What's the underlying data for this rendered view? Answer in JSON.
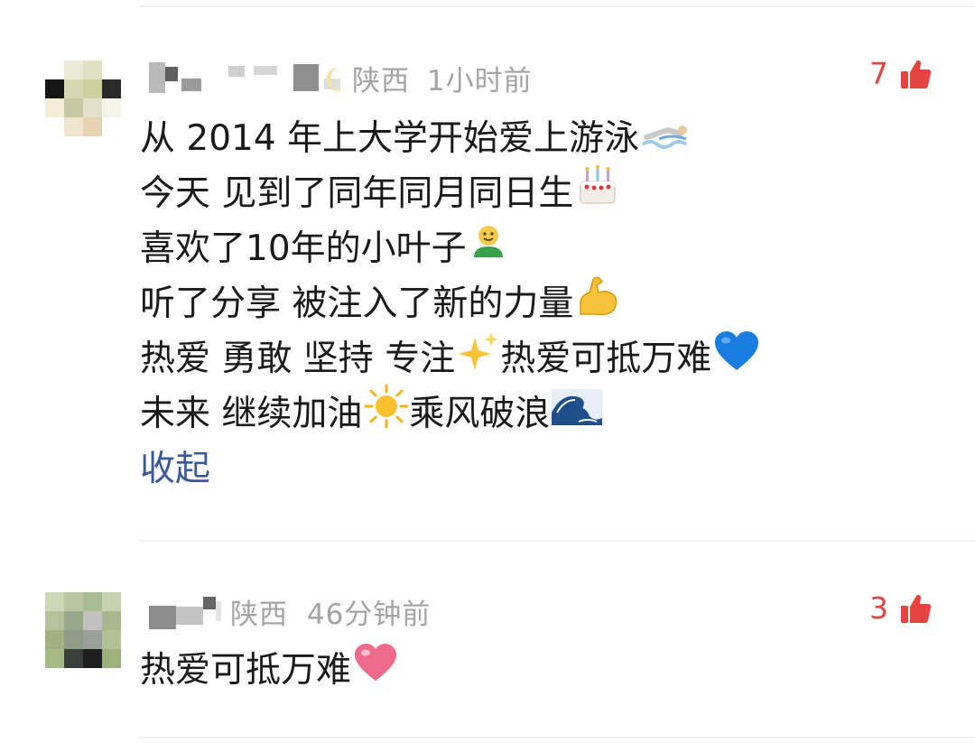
{
  "comments": [
    {
      "location": "陕西",
      "time": "1小时前",
      "likes": "7",
      "lines": [
        {
          "text": "从 2014 年上大学开始爱上游泳",
          "emoji": "swimmer-icon"
        },
        {
          "text": "今天 见到了同年同月同日生",
          "emoji": "cake-icon"
        },
        {
          "text": "喜欢了10年的小叶子",
          "emoji": "smiley-person-icon"
        },
        {
          "text": "听了分享 被注入了新的力量",
          "emoji": "flexed-biceps-icon"
        },
        {
          "text": "热爱 勇敢 坚持 专注",
          "emoji": "sparkles-icon",
          "text2": "热爱可抵万难",
          "emoji2": "blue-heart-icon"
        },
        {
          "text": "未来 继续加油 ",
          "emoji": "sun-icon",
          "text2": " 乘风破浪",
          "emoji2": "wave-icon"
        }
      ],
      "collapse_label": "收起"
    },
    {
      "location": "陕西",
      "time": "46分钟前",
      "likes": "3",
      "lines": [
        {
          "text": "热爱可抵万难",
          "emoji": "pink-heart-icon"
        }
      ]
    }
  ],
  "colors": {
    "like_red": "#e64340",
    "meta_gray": "#a3a3a3",
    "link_blue": "#3b5998",
    "text": "#1a1a1a"
  }
}
